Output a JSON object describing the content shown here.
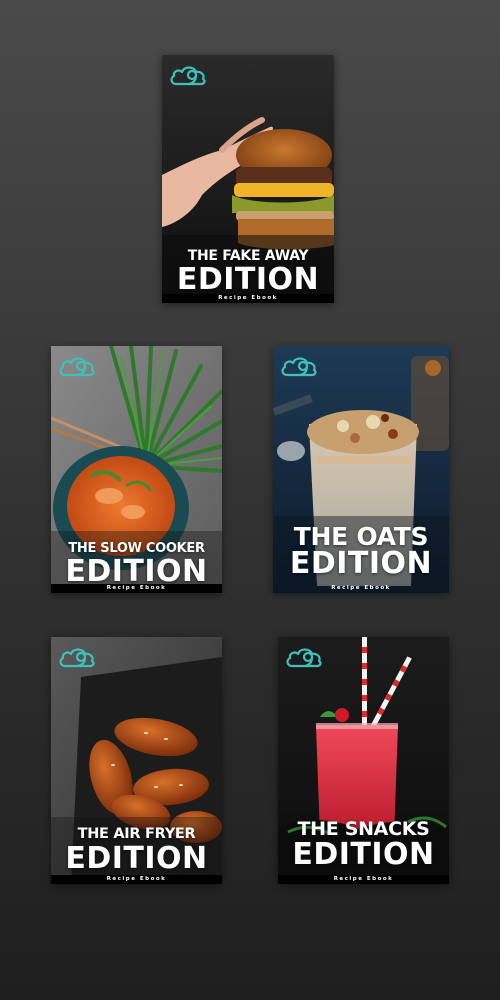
{
  "brand": {
    "accent_color": "#3fc1b9",
    "logo_icon": "cloud-9-logo-icon"
  },
  "ebooks": [
    {
      "id": "fakeaway",
      "title_top": "THE FAKE AWAY",
      "title_main": "EDITION",
      "subtitle": "Recipe Ebook",
      "image": "burger-photo"
    },
    {
      "id": "slowcooker",
      "title_top": "THE SLOW COOKER",
      "title_main": "EDITION",
      "subtitle": "Recipe Ebook",
      "image": "thai-curry-photo"
    },
    {
      "id": "oats",
      "title_top": "THE OATS",
      "title_main": "EDITION",
      "subtitle": "Recipe Ebook",
      "image": "overnight-oats-photo"
    },
    {
      "id": "airfryer",
      "title_top": "THE AIR FRYER",
      "title_main": "EDITION",
      "subtitle": "Recipe Ebook",
      "image": "chicken-wings-photo"
    },
    {
      "id": "snacks",
      "title_top": "THE SNACKS",
      "title_main": "EDITION",
      "subtitle": "Recipe Ebook",
      "image": "smoothie-photo"
    }
  ]
}
